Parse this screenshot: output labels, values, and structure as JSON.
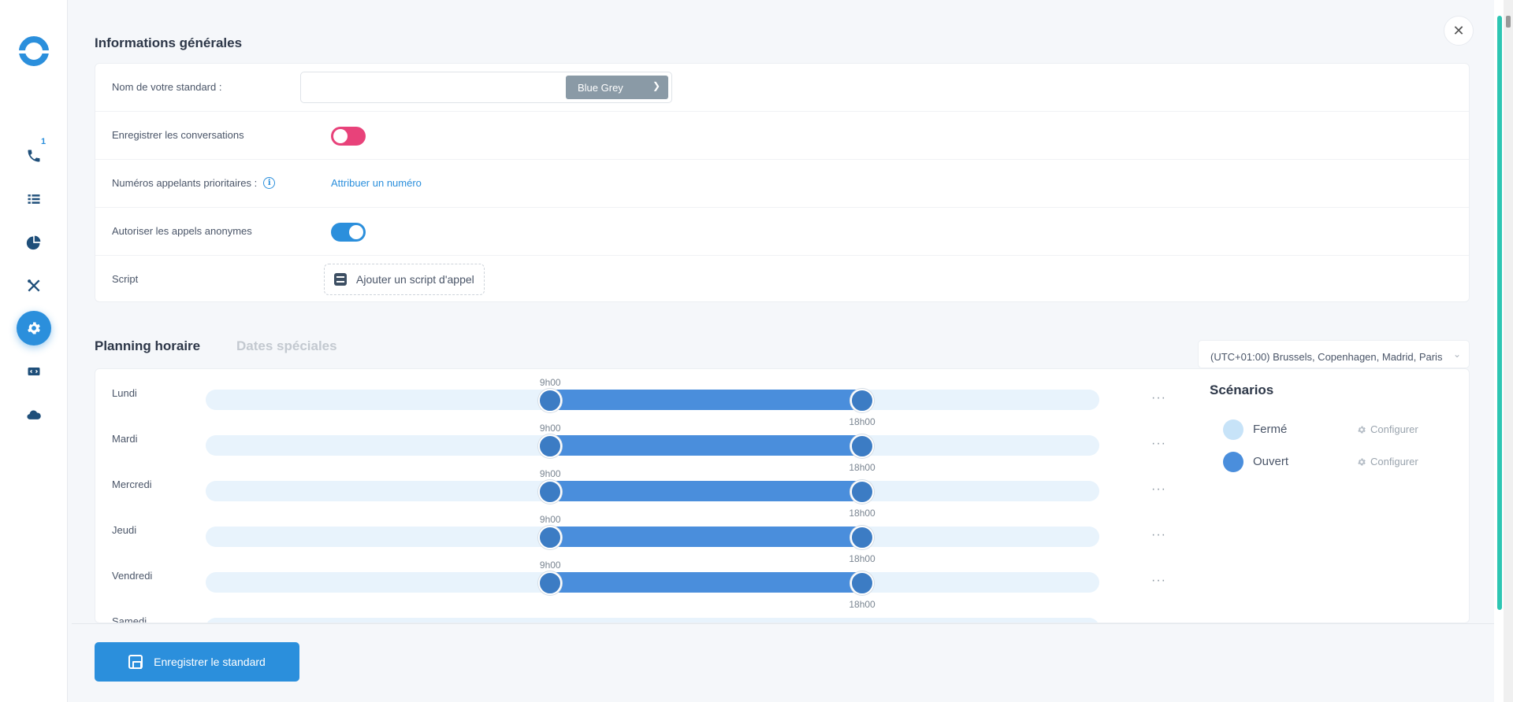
{
  "sidebar": {
    "items": [
      {
        "name": "phone-icon",
        "badge": "1"
      },
      {
        "name": "list-icon"
      },
      {
        "name": "chart-icon"
      },
      {
        "name": "tools-icon"
      },
      {
        "name": "gear-icon",
        "active": true
      },
      {
        "name": "code-icon"
      },
      {
        "name": "cloud-icon"
      }
    ]
  },
  "general": {
    "title": "Informations générales",
    "name_label": "Nom de votre standard :",
    "name_value": "",
    "color_selected": "Blue Grey",
    "record_label": "Enregistrer les conversations",
    "record_enabled": false,
    "priority_label": "Numéros appelants prioritaires :",
    "priority_link": "Attribuer un numéro",
    "anonymous_label": "Autoriser les appels anonymes",
    "anonymous_enabled": true,
    "script_label": "Script",
    "script_button": "Ajouter un script d'appel"
  },
  "planning": {
    "tab_active": "Planning horaire",
    "tab_inactive": "Dates spéciales",
    "timezone": "(UTC+01:00) Brussels, Copenhagen, Madrid, Paris",
    "days": [
      {
        "label": "Lundi",
        "start": "9h00",
        "end": "18h00",
        "start_fraction": 0.3856,
        "end_fraction": 0.7346
      },
      {
        "label": "Mardi",
        "start": "9h00",
        "end": "18h00",
        "start_fraction": 0.3856,
        "end_fraction": 0.7346
      },
      {
        "label": "Mercredi",
        "start": "9h00",
        "end": "18h00",
        "start_fraction": 0.3856,
        "end_fraction": 0.7346
      },
      {
        "label": "Jeudi",
        "start": "9h00",
        "end": "18h00",
        "start_fraction": 0.3856,
        "end_fraction": 0.7346
      },
      {
        "label": "Vendredi",
        "start": "9h00",
        "end": "18h00",
        "start_fraction": 0.3856,
        "end_fraction": 0.7346
      },
      {
        "label": "Samedi",
        "start": "",
        "end": ""
      }
    ],
    "more_label": "···"
  },
  "scenarios": {
    "title": "Scénarios",
    "items": [
      {
        "name": "Fermé",
        "color": "#c7e3f8",
        "configure": "Configurer"
      },
      {
        "name": "Ouvert",
        "color": "#4a8edc",
        "configure": "Configurer"
      }
    ]
  },
  "footer": {
    "save_label": "Enregistrer le standard"
  },
  "colors": {
    "accent": "#2b8fdc",
    "toggle_off": "#e8427a",
    "range": "#4a8edc"
  }
}
